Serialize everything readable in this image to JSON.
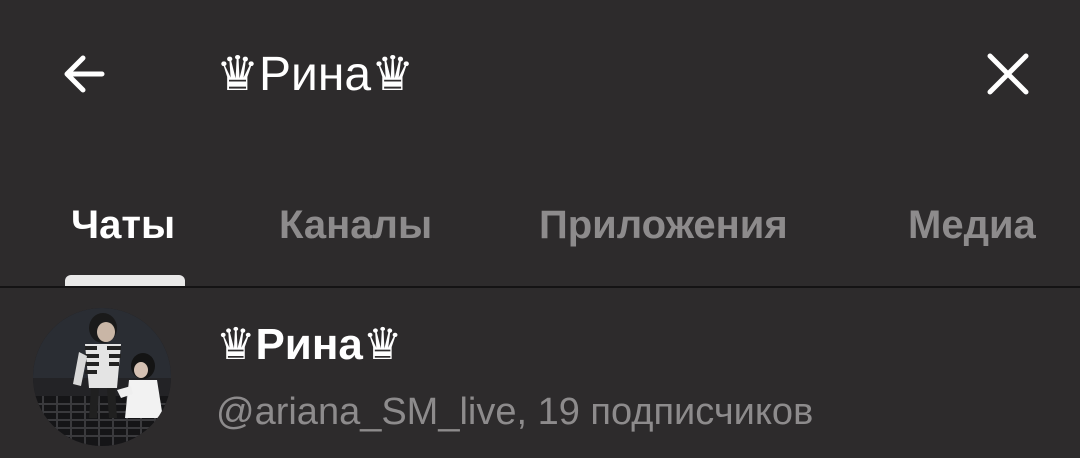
{
  "header": {
    "back_icon": "arrow-left-icon",
    "search_value": "♛Рина♛",
    "close_icon": "close-icon"
  },
  "tabs": [
    {
      "label": "Чаты",
      "active": true
    },
    {
      "label": "Каналы",
      "active": false
    },
    {
      "label": "Приложения",
      "active": false
    },
    {
      "label": "Медиа",
      "active": false
    }
  ],
  "results": [
    {
      "title": "♛Рина♛",
      "subtitle": "@ariana_SM_live, 19 подписчиков",
      "avatar": "avatar-photo"
    }
  ],
  "colors": {
    "background": "#2d2b2c",
    "text_primary": "#ffffff",
    "text_secondary": "#8d8b8c",
    "indicator": "#e9e9e9"
  }
}
